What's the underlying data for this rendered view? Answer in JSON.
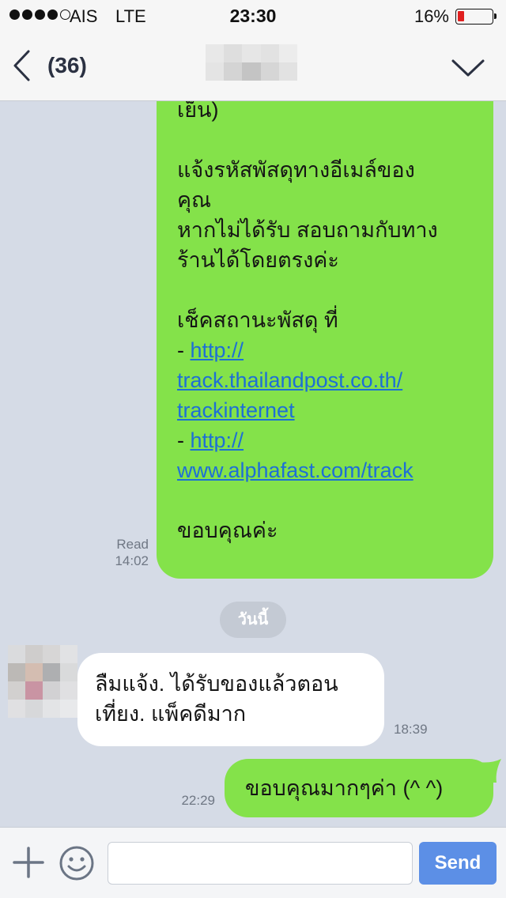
{
  "status_bar": {
    "carrier": "AIS",
    "network": "LTE",
    "time": "23:30",
    "battery_percent": "16%",
    "battery_level": 0.16,
    "signal_bars": 4,
    "signal_max": 5
  },
  "nav": {
    "unread_count": "(36)"
  },
  "messages": {
    "outgoing_long": {
      "lines": [
        "เย็น)",
        "",
        "แจ้งรหัสพัสดุทางอีเมล์ของ",
        "คุณ",
        "หากไม่ได้รับ สอบถามกับทาง",
        "ร้านได้โดยตรงค่ะ",
        "",
        "เช็คสถานะพัสดุ ที่"
      ],
      "link1_prefix": "- ",
      "link1_line1": "http://",
      "link1_line2": "track.thailandpost.co.th/",
      "link1_line3": "trackinternet",
      "link2_prefix": "- ",
      "link2_line1": "http://",
      "link2_line2": "www.alphafast.com/track",
      "closing": "ขอบคุณค่ะ",
      "read_label": "Read",
      "time": "14:02"
    },
    "date_divider": "วันนี้",
    "incoming": {
      "line1": "ลืมแจ้ง. ได้รับของแล้วตอน",
      "line2": "เที่ยง. แพ็คดีมาก",
      "time": "18:39"
    },
    "outgoing_short": {
      "text": "ขอบคุณมากๆค่า (^ ^)",
      "time": "22:29"
    }
  },
  "input_bar": {
    "placeholder": "",
    "send_label": "Send"
  },
  "colors": {
    "outgoing_bubble": "#84e24a",
    "incoming_bubble": "#ffffff",
    "chat_background": "#d5dbe6",
    "send_button": "#5c8fe6",
    "link": "#1d6fd6",
    "battery_low": "#e02020"
  },
  "icons": {
    "back": "chevron-left-icon",
    "menu": "chevron-down-icon",
    "add": "plus-icon",
    "emoji": "emoji-icon"
  }
}
